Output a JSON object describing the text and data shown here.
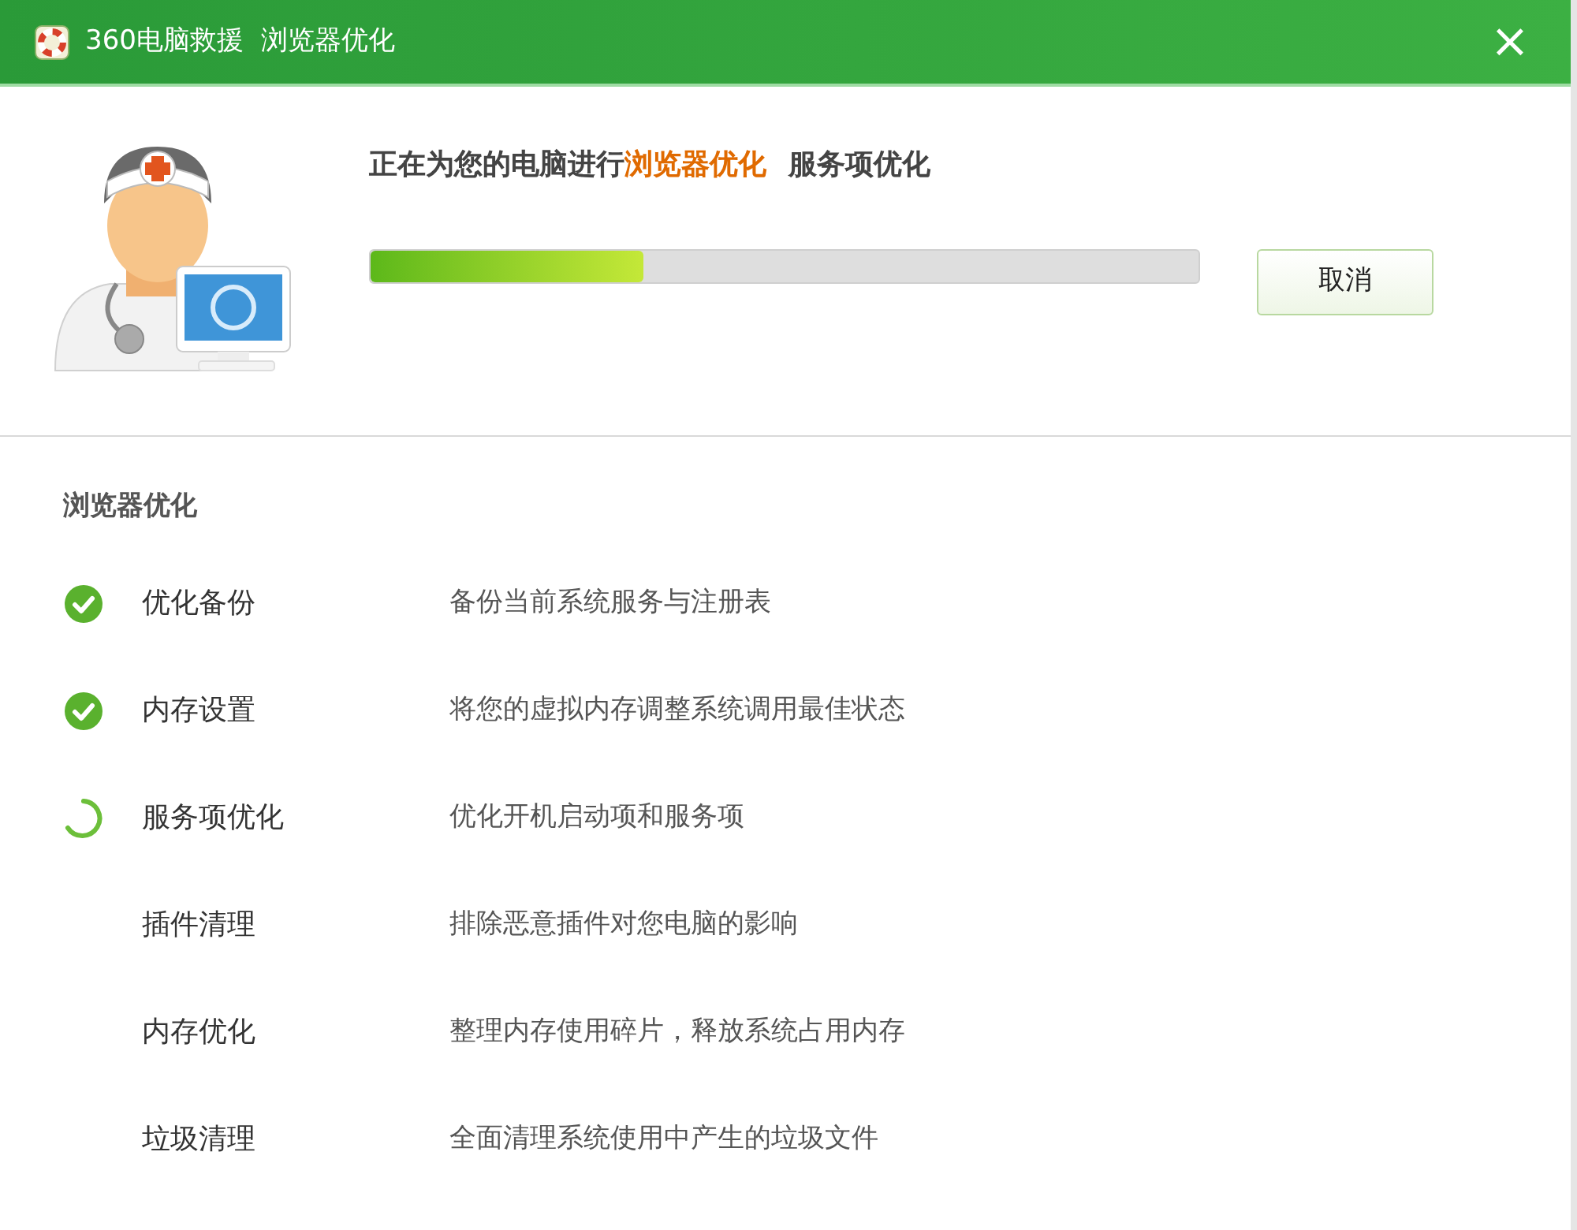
{
  "window": {
    "title": "360电脑救援  浏览器优化",
    "close": "×"
  },
  "status": {
    "prefix": "正在为您的电脑进行",
    "current": "浏览器优化",
    "next": "服务项优化"
  },
  "progress": {
    "level": 0.33
  },
  "cancel_button": "取消",
  "section_title": "浏览器优化",
  "tasks": [
    {
      "kind": "done",
      "name": "优化备份",
      "description": "备份当前系统服务与注册表"
    },
    {
      "kind": "done",
      "name": "内存设置",
      "description": "将您的虚拟内存调整系统调用最佳状态"
    },
    {
      "kind": "running",
      "name": "服务项优化",
      "description": "优化开机启动项和服务项"
    },
    {
      "kind": "pending",
      "name": "插件清理",
      "description": "排除恶意插件对您电脑的影响"
    },
    {
      "kind": "pending",
      "name": "内存优化",
      "description": "整理内存使用碎片，释放系统占用内存"
    },
    {
      "kind": "pending",
      "name": "垃圾清理",
      "description": "全面清理系统使用中产生的垃圾文件"
    }
  ]
}
